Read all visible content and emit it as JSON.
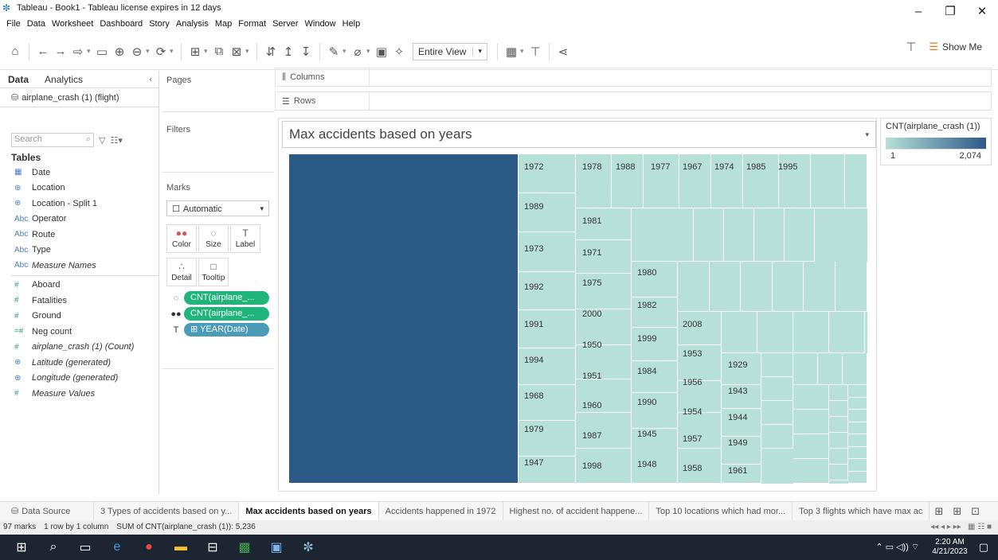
{
  "window": {
    "title": "Tableau - Book1 - Tableau license expires in 12 days"
  },
  "menu": [
    "File",
    "Data",
    "Worksheet",
    "Dashboard",
    "Story",
    "Analysis",
    "Map",
    "Format",
    "Server",
    "Window",
    "Help"
  ],
  "toolbar": {
    "view_fit": "Entire View",
    "show_me": "Show Me"
  },
  "data_pane": {
    "tabs": [
      "Data",
      "Analytics"
    ],
    "datasource": "airplane_crash (1) (flight)",
    "search_placeholder": "Search",
    "tables_heading": "Tables",
    "dimensions": [
      {
        "icon": "date",
        "glyph": "▦",
        "name": "Date"
      },
      {
        "icon": "geo",
        "glyph": "⊕",
        "name": "Location"
      },
      {
        "icon": "geo",
        "glyph": "⊕",
        "name": "Location - Split 1"
      },
      {
        "icon": "abc",
        "glyph": "Abc",
        "name": "Operator"
      },
      {
        "icon": "abc",
        "glyph": "Abc",
        "name": "Route"
      },
      {
        "icon": "abc",
        "glyph": "Abc",
        "name": "Type"
      },
      {
        "icon": "abc",
        "glyph": "Abc",
        "name": "Measure Names",
        "italic": true
      }
    ],
    "measures": [
      {
        "icon": "num",
        "glyph": "#",
        "name": "Aboard"
      },
      {
        "icon": "num",
        "glyph": "#",
        "name": "Fatalities"
      },
      {
        "icon": "num",
        "glyph": "#",
        "name": "Ground"
      },
      {
        "icon": "num",
        "glyph": "=#",
        "name": "Neg count"
      },
      {
        "icon": "num",
        "glyph": "#",
        "name": "airplane_crash (1) (Count)",
        "italic": true
      },
      {
        "icon": "geo",
        "glyph": "⊕",
        "name": "Latitude (generated)",
        "italic": true
      },
      {
        "icon": "geo",
        "glyph": "⊕",
        "name": "Longitude (generated)",
        "italic": true
      },
      {
        "icon": "num",
        "glyph": "#",
        "name": "Measure Values",
        "italic": true
      }
    ]
  },
  "cards": {
    "pages": "Pages",
    "filters": "Filters",
    "marks": "Marks",
    "mark_type": "Automatic",
    "mark_buttons": [
      {
        "name": "color",
        "glyph": "●●",
        "label": "Color"
      },
      {
        "name": "size",
        "glyph": "◌",
        "label": "Size"
      },
      {
        "name": "label",
        "glyph": "T",
        "label": "Label"
      },
      {
        "name": "detail",
        "glyph": "∴",
        "label": "Detail"
      },
      {
        "name": "tooltip",
        "glyph": "□",
        "label": "Tooltip"
      }
    ],
    "pills": [
      {
        "icon": "◌",
        "text": "CNT(airplane_...",
        "color": "#1fb57a"
      },
      {
        "icon": "●●",
        "text": "CNT(airplane_...",
        "color": "#1fb57a"
      },
      {
        "icon": "T",
        "text": "⊞ YEAR(Date)",
        "color": "#4a9bb8"
      }
    ]
  },
  "shelves": {
    "columns": "Columns",
    "rows": "Rows"
  },
  "viz": {
    "title": "Max accidents based on years",
    "colors": {
      "max": "#2b5a87",
      "min": "#b7e0d8"
    }
  },
  "legend": {
    "title": "CNT(airplane_crash (1))",
    "min": "1",
    "max": "2,074"
  },
  "chart_data": {
    "type": "treemap",
    "title": "Max accidents based on years",
    "size_and_color": "CNT(airplane_crash (1))",
    "labels": [
      "1972",
      "1978",
      "1988",
      "1977",
      "1967",
      "1974",
      "1985",
      "1995",
      "1989",
      "1981",
      "1973",
      "1971",
      "1980",
      "1992",
      "1975",
      "1982",
      "2000",
      "1991",
      "2008",
      "1999",
      "1950",
      "1953",
      "1994",
      "1929",
      "1984",
      "1951",
      "1956",
      "1943",
      "1968",
      "1990",
      "1960",
      "1954",
      "1944",
      "1979",
      "1945",
      "1987",
      "1957",
      "1949",
      "1947",
      "1948",
      "1998",
      "1958",
      "1961"
    ]
  },
  "sheet_tabs": {
    "data_source": "Data Source",
    "tabs": [
      "3 Types of accidents based on y...",
      "Max accidents based on years",
      "Accidents happened in 1972",
      "Highest no. of accident happene...",
      "Top 10 locations which had mor...",
      "Top 3 flights which have max ac"
    ],
    "active": 1
  },
  "status": {
    "marks": "97 marks",
    "layout": "1 row by 1 column",
    "sum": "SUM of CNT(airplane_crash (1)): 5,236"
  },
  "taskbar": {
    "time": "2:20 AM",
    "date": "4/21/2023"
  }
}
